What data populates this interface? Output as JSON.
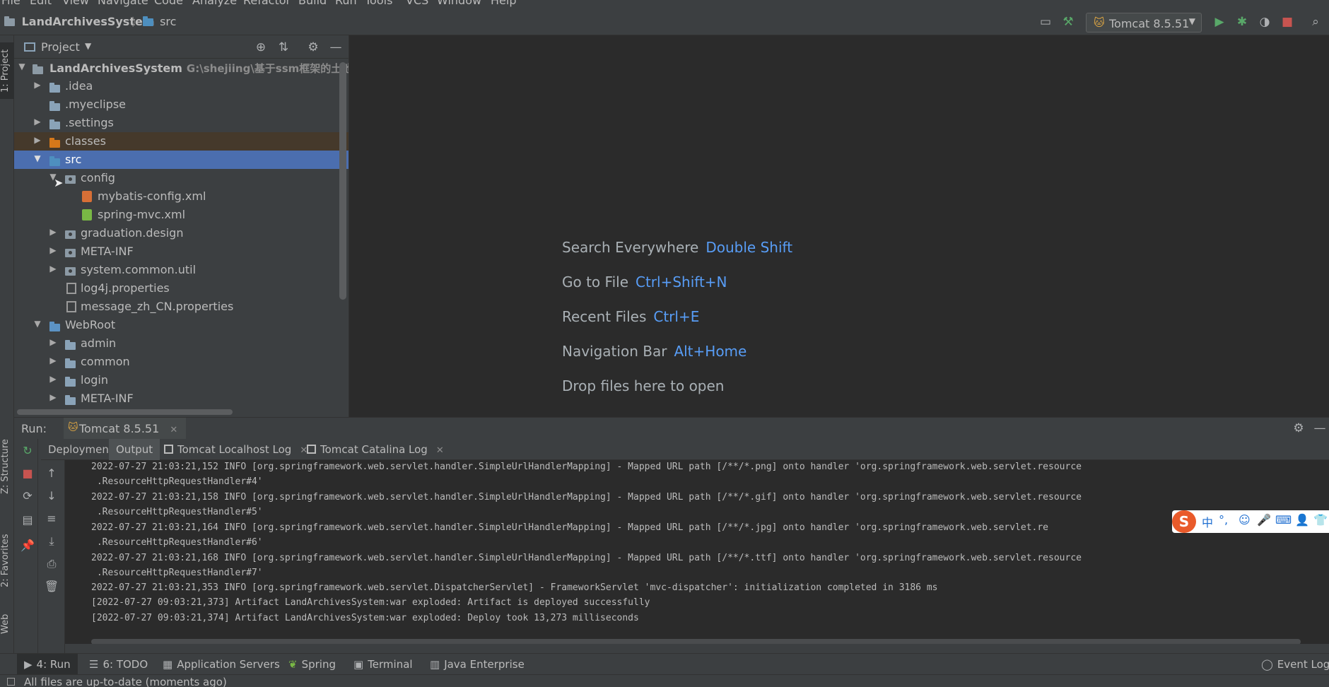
{
  "menu": {
    "items": [
      "File",
      "Edit",
      "View",
      "Navigate",
      "Code",
      "Analyze",
      "Refactor",
      "Build",
      "Run",
      "Tools",
      "VCS",
      "Window",
      "Help"
    ]
  },
  "navbar": {
    "project_crumb": "LandArchivesSystem",
    "folder_crumb": "src",
    "run_config": "Tomcat 8.5.51"
  },
  "left_strip": {
    "project_tab": "1: Project",
    "structure_tab": "Z: Structure",
    "favorites_tab": "2: Favorites",
    "web_tab": "Web"
  },
  "project_panel": {
    "title": "Project",
    "tree": [
      {
        "label": "LandArchivesSystem",
        "path": "G:\\shejiing\\基于ssm框架的土地档案管",
        "depth": 0,
        "expanded": true,
        "icon": "module-folder-icon"
      },
      {
        "label": ".idea",
        "depth": 1,
        "expanded": false,
        "icon": "folder-icon"
      },
      {
        "label": ".myeclipse",
        "depth": 1,
        "leaf": true,
        "icon": "folder-icon"
      },
      {
        "label": ".settings",
        "depth": 1,
        "expanded": false,
        "icon": "folder-icon"
      },
      {
        "label": "classes",
        "depth": 1,
        "expanded": false,
        "icon": "excluded-folder-icon"
      },
      {
        "label": "src",
        "depth": 1,
        "expanded": true,
        "icon": "source-folder-icon"
      },
      {
        "label": "config",
        "depth": 2,
        "expanded": true,
        "icon": "package-icon"
      },
      {
        "label": "mybatis-config.xml",
        "depth": 3,
        "leaf": true,
        "icon": "xml-file-icon"
      },
      {
        "label": "spring-mvc.xml",
        "depth": 3,
        "leaf": true,
        "icon": "spring-xml-icon"
      },
      {
        "label": "graduation.design",
        "depth": 2,
        "expanded": false,
        "icon": "package-icon"
      },
      {
        "label": "META-INF",
        "depth": 2,
        "expanded": false,
        "icon": "package-icon"
      },
      {
        "label": "system.common.util",
        "depth": 2,
        "expanded": false,
        "icon": "package-icon"
      },
      {
        "label": "log4j.properties",
        "depth": 2,
        "leaf": true,
        "icon": "properties-file-icon"
      },
      {
        "label": "message_zh_CN.properties",
        "depth": 2,
        "leaf": true,
        "icon": "properties-file-icon"
      },
      {
        "label": "WebRoot",
        "depth": 1,
        "expanded": true,
        "icon": "web-folder-icon"
      },
      {
        "label": "admin",
        "depth": 2,
        "expanded": false,
        "icon": "folder-icon"
      },
      {
        "label": "common",
        "depth": 2,
        "expanded": false,
        "icon": "folder-icon"
      },
      {
        "label": "login",
        "depth": 2,
        "expanded": false,
        "icon": "folder-icon"
      },
      {
        "label": "META-INF",
        "depth": 2,
        "expanded": false,
        "icon": "folder-icon"
      }
    ]
  },
  "editor": {
    "hints": [
      {
        "label": "Search Everywhere",
        "shortcut": "Double Shift"
      },
      {
        "label": "Go to File",
        "shortcut": "Ctrl+Shift+N"
      },
      {
        "label": "Recent Files",
        "shortcut": "Ctrl+E"
      },
      {
        "label": "Navigation Bar",
        "shortcut": "Alt+Home"
      },
      {
        "label": "Drop files here to open",
        "shortcut": ""
      }
    ]
  },
  "run_panel": {
    "label": "Run:",
    "tab": "Tomcat 8.5.51",
    "output_tabs": [
      "Deployment",
      "Output",
      "Tomcat Localhost Log",
      "Tomcat Catalina Log"
    ],
    "active_output_tab": "Output",
    "log_lines": [
      "2022-07-27 21:03:21,152 INFO [org.springframework.web.servlet.handler.SimpleUrlHandlerMapping] - Mapped URL path [/**/*.png] onto handler 'org.springframework.web.servlet.resource",
      " .ResourceHttpRequestHandler#4'",
      "2022-07-27 21:03:21,158 INFO [org.springframework.web.servlet.handler.SimpleUrlHandlerMapping] - Mapped URL path [/**/*.gif] onto handler 'org.springframework.web.servlet.resource",
      " .ResourceHttpRequestHandler#5'",
      "2022-07-27 21:03:21,164 INFO [org.springframework.web.servlet.handler.SimpleUrlHandlerMapping] - Mapped URL path [/**/*.jpg] onto handler 'org.springframework.web.servlet.re",
      " .ResourceHttpRequestHandler#6'",
      "2022-07-27 21:03:21,168 INFO [org.springframework.web.servlet.handler.SimpleUrlHandlerMapping] - Mapped URL path [/**/*.ttf] onto handler 'org.springframework.web.servlet.resource",
      " .ResourceHttpRequestHandler#7'",
      "2022-07-27 21:03:21,353 INFO [org.springframework.web.servlet.DispatcherServlet] - FrameworkServlet 'mvc-dispatcher': initialization completed in 3186 ms",
      "[2022-07-27 09:03:21,373] Artifact LandArchivesSystem:war exploded: Artifact is deployed successfully",
      "[2022-07-27 09:03:21,374] Artifact LandArchivesSystem:war exploded: Deploy took 13,273 milliseconds"
    ]
  },
  "ime": {
    "logo": "S",
    "mode": "中",
    "punct": "°,"
  },
  "bottom_bar": {
    "tabs": [
      "4: Run",
      "6: TODO",
      "Application Servers",
      "Spring",
      "Terminal",
      "Java Enterprise"
    ],
    "event_log": "Event Log"
  },
  "status_bar": {
    "message": "All files are up-to-date (moments ago)"
  },
  "colors": {
    "accent_blue": "#4b6eaf",
    "shortcut_blue": "#589df6",
    "run_green": "#59a869",
    "stop_red": "#c75450"
  }
}
